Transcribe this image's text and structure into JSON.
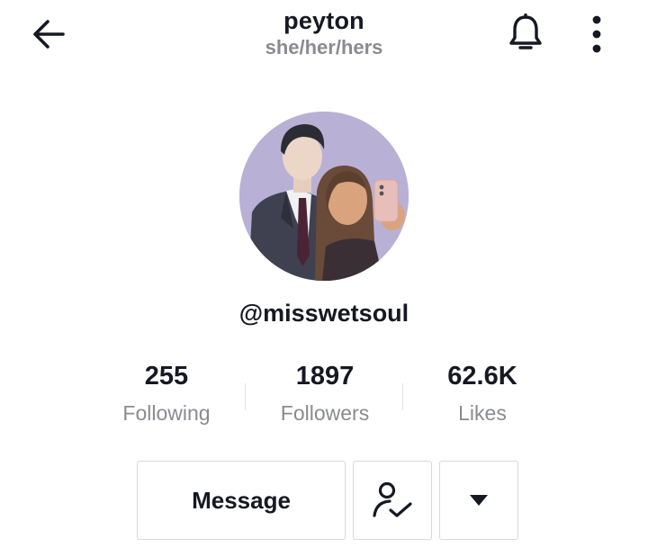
{
  "header": {
    "name": "peyton",
    "pronouns": "she/her/hers",
    "back_icon": "arrow-left-icon",
    "bell_icon": "bell-icon",
    "more_icon": "vertical-dots-icon"
  },
  "profile": {
    "handle": "@misswetsoul",
    "avatar": "avatar-image"
  },
  "stats": [
    {
      "value": "255",
      "label": "Following"
    },
    {
      "value": "1897",
      "label": "Followers"
    },
    {
      "value": "62.6K",
      "label": "Likes"
    }
  ],
  "actions": {
    "message_label": "Message",
    "friends_icon": "user-check-icon",
    "dropdown_icon": "caret-down-icon"
  },
  "colors": {
    "primary_text": "#161823",
    "secondary_text": "#8a8b91",
    "button_border": "#d8d8da",
    "avatar_background": "#b9b0d6"
  }
}
